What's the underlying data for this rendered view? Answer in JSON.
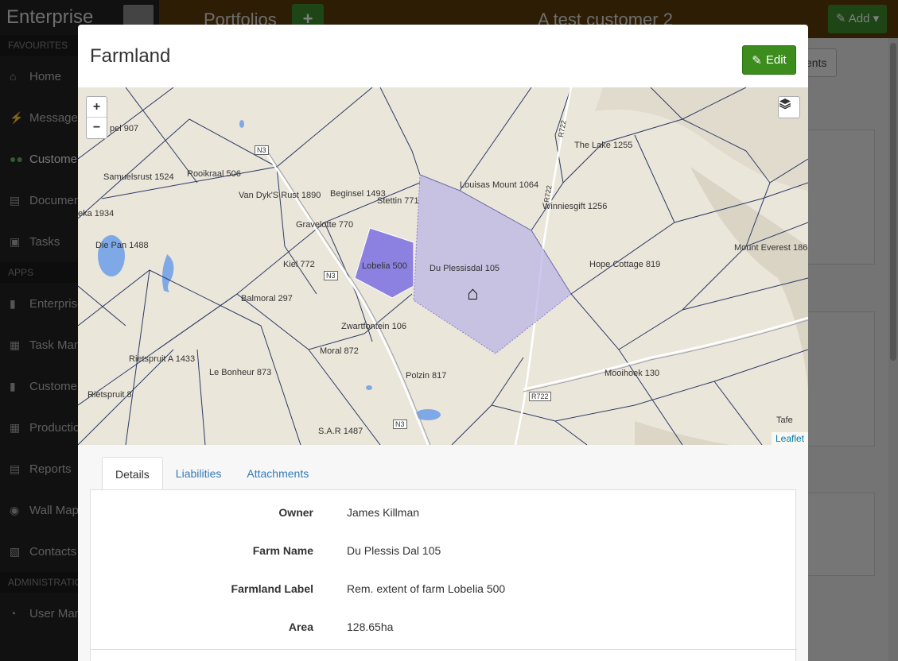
{
  "app": {
    "brand": "Enterprise",
    "sidebar": {
      "favourites_label": "FAVOURITES",
      "apps_label": "APPS",
      "admin_label": "ADMINISTRATION",
      "items": [
        {
          "label": "Home",
          "icon": "home-icon"
        },
        {
          "label": "Messages",
          "icon": "bolt-icon"
        },
        {
          "label": "Customers",
          "icon": "users-icon"
        },
        {
          "label": "Documents",
          "icon": "document-icon"
        },
        {
          "label": "Tasks",
          "icon": "briefcase-icon"
        },
        {
          "label": "Enterprise",
          "icon": "bar-chart-icon"
        },
        {
          "label": "Task Manager",
          "icon": "calendar-icon"
        },
        {
          "label": "Customers",
          "icon": "bar-chart-icon"
        },
        {
          "label": "Production",
          "icon": "calendar-icon"
        },
        {
          "label": "Reports",
          "icon": "document-icon"
        },
        {
          "label": "Wall Map",
          "icon": "globe-icon"
        },
        {
          "label": "Contacts",
          "icon": "contact-icon"
        },
        {
          "label": "User Management",
          "icon": "user-icon"
        }
      ]
    },
    "topbar": {
      "portfolios": "Portfolios",
      "plus": "+",
      "customer": "A test customer 2",
      "add": "Add"
    },
    "bg_button": "ents"
  },
  "modal": {
    "title": "Farmland",
    "edit_label": "Edit",
    "map": {
      "zoom_in": "+",
      "zoom_out": "−",
      "attribution": "Leaflet",
      "labels": [
        "Samuelsrust 1524",
        "Rooikraal 506",
        "Van Dyk'S Rust 1890",
        "Beginsel 1493",
        "Stettin 771",
        "Louisas Mount 1064",
        "Winniesgift 1256",
        "The Lake 1255",
        "Gravelotte 770",
        "Lobelia 500",
        "Du Plessisdal 105",
        "Hope Cottage 819",
        "Mount Everest 186",
        "Kiel 772",
        "Die Pan 1488",
        "Balmoral 297",
        "Zwartfontein 106",
        "Moral 872",
        "Rietspruit A 1433",
        "Le Bonheur 873",
        "Polzin 817",
        "Mooihoek 130",
        "Rietspruit 8",
        "S.A.R 1487",
        "pel 907",
        "eka 1934",
        "N3",
        "N3",
        "N3",
        "R722",
        "R722",
        "R722",
        "Tafe"
      ]
    },
    "tabs": [
      "Details",
      "Liabilities",
      "Attachments"
    ],
    "details": [
      {
        "label": "Owner",
        "value": "James Killman"
      },
      {
        "label": "Farm Name",
        "value": "Du Plessis Dal 105"
      },
      {
        "label": "Farmland Label",
        "value": "Rem. extent of farm Lobelia 500"
      },
      {
        "label": "Area",
        "value": "128.65ha"
      }
    ]
  },
  "colors": {
    "accent_green": "#3c8d1e",
    "topbar_brown": "#5b3a0b",
    "selected_parcel": "#7b6fe0",
    "farm_parcel": "#b8b0e6"
  }
}
